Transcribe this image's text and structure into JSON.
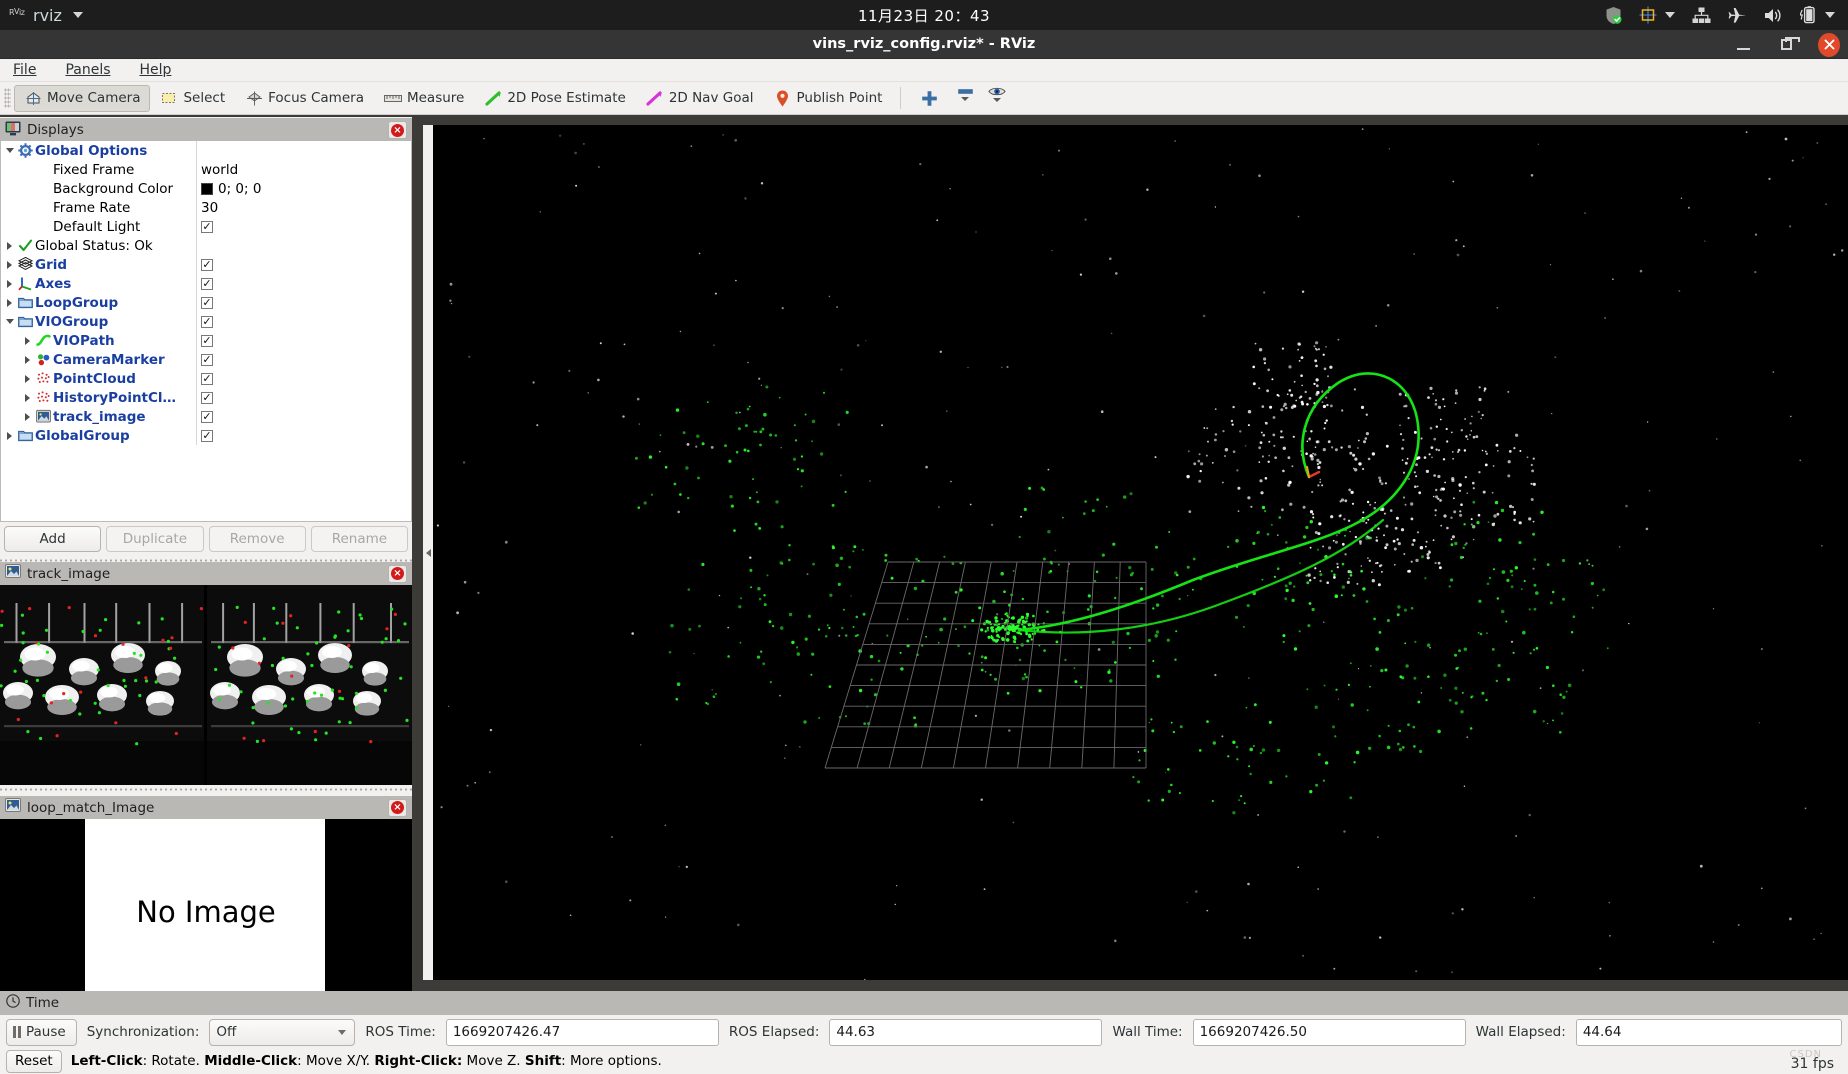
{
  "topbar": {
    "app_menu_label": "rviz",
    "clock": "11月23日  20：43",
    "tray_icons": [
      "shield-check-icon",
      "ime-chinese-icon",
      "network-icon",
      "airplane-mode-icon",
      "volume-icon",
      "battery-charging-icon"
    ]
  },
  "window": {
    "title": "vins_rviz_config.rviz* - RViz",
    "minimize_label": "−",
    "maximize_label": "□",
    "close_label": "✕"
  },
  "menubar": {
    "items": [
      "File",
      "Panels",
      "Help"
    ]
  },
  "toolbar": {
    "buttons": [
      {
        "label": "Move Camera",
        "icon": "move-camera-icon",
        "checked": true
      },
      {
        "label": "Select",
        "icon": "select-icon",
        "checked": false
      },
      {
        "label": "Focus Camera",
        "icon": "focus-camera-icon",
        "checked": false
      },
      {
        "label": "Measure",
        "icon": "measure-icon",
        "checked": false
      },
      {
        "label": "2D Pose Estimate",
        "icon": "pose-estimate-icon",
        "checked": false
      },
      {
        "label": "2D Nav Goal",
        "icon": "nav-goal-icon",
        "checked": false
      },
      {
        "label": "Publish Point",
        "icon": "publish-point-icon",
        "checked": false
      }
    ],
    "extra_icons": [
      "plus-icon",
      "minus-icon",
      "eye-icon"
    ]
  },
  "displays_panel": {
    "title": "Displays",
    "close_label": "×",
    "tree": [
      {
        "indent": 0,
        "twisty": "open",
        "icon": "gear-icon",
        "label": "Global Options",
        "bold": true,
        "value_type": "none",
        "value": ""
      },
      {
        "indent": 1,
        "twisty": "none",
        "icon": "none",
        "label": "Fixed Frame",
        "bold": false,
        "value_type": "text",
        "value": "world"
      },
      {
        "indent": 1,
        "twisty": "none",
        "icon": "none",
        "label": "Background Color",
        "bold": false,
        "value_type": "color",
        "value": "0; 0; 0",
        "color": "#000000"
      },
      {
        "indent": 1,
        "twisty": "none",
        "icon": "none",
        "label": "Frame Rate",
        "bold": false,
        "value_type": "text",
        "value": "30"
      },
      {
        "indent": 1,
        "twisty": "none",
        "icon": "none",
        "label": "Default Light",
        "bold": false,
        "value_type": "checkbox",
        "value": "✓"
      },
      {
        "indent": 0,
        "twisty": "closed",
        "icon": "check-icon",
        "label": "Global Status: Ok",
        "bold": false,
        "value_type": "none",
        "value": ""
      },
      {
        "indent": 0,
        "twisty": "closed",
        "icon": "grid-icon",
        "label": "Grid",
        "bold": true,
        "value_type": "checkbox",
        "value": "✓"
      },
      {
        "indent": 0,
        "twisty": "closed",
        "icon": "axes-icon",
        "label": "Axes",
        "bold": true,
        "value_type": "checkbox",
        "value": "✓"
      },
      {
        "indent": 0,
        "twisty": "closed",
        "icon": "folder-icon",
        "label": "LoopGroup",
        "bold": true,
        "value_type": "checkbox",
        "value": "✓"
      },
      {
        "indent": 0,
        "twisty": "open",
        "icon": "folder-icon",
        "label": "VIOGroup",
        "bold": true,
        "value_type": "checkbox",
        "value": "✓"
      },
      {
        "indent": 1,
        "twisty": "closed",
        "icon": "path-icon",
        "label": "VIOPath",
        "bold": true,
        "value_type": "checkbox",
        "value": "✓"
      },
      {
        "indent": 1,
        "twisty": "closed",
        "icon": "marker-icon",
        "label": "CameraMarker",
        "bold": true,
        "value_type": "checkbox",
        "value": "✓"
      },
      {
        "indent": 1,
        "twisty": "closed",
        "icon": "pointcloud-icon",
        "label": "PointCloud",
        "bold": true,
        "value_type": "checkbox",
        "value": "✓"
      },
      {
        "indent": 1,
        "twisty": "closed",
        "icon": "pointcloud-icon",
        "label": "HistoryPointCl…",
        "bold": true,
        "value_type": "checkbox",
        "value": "✓"
      },
      {
        "indent": 1,
        "twisty": "closed",
        "icon": "image-icon",
        "label": "track_image",
        "bold": true,
        "value_type": "checkbox",
        "value": "✓"
      },
      {
        "indent": 0,
        "twisty": "closed",
        "icon": "folder-icon",
        "label": "GlobalGroup",
        "bold": true,
        "value_type": "checkbox",
        "value": "✓"
      }
    ],
    "buttons": [
      {
        "label": "Add",
        "enabled": true
      },
      {
        "label": "Duplicate",
        "enabled": false
      },
      {
        "label": "Remove",
        "enabled": false
      },
      {
        "label": "Rename",
        "enabled": false
      }
    ]
  },
  "track_image_panel": {
    "title": "track_image",
    "close_label": "×"
  },
  "loop_match_panel": {
    "title": "loop_match_Image",
    "close_label": "×",
    "placeholder_text": "No Image"
  },
  "time_panel": {
    "title": "Time",
    "pause_label": "Pause",
    "sync_label": "Synchronization:",
    "sync_value": "Off",
    "ros_time_label": "ROS Time:",
    "ros_time_value": "1669207426.47",
    "ros_elapsed_label": "ROS Elapsed:",
    "ros_elapsed_value": "44.63",
    "wall_time_label": "Wall Time:",
    "wall_time_value": "1669207426.50",
    "wall_elapsed_label": "Wall Elapsed:",
    "wall_elapsed_value": "44.64",
    "reset_label": "Reset",
    "hint_parts": [
      "Left-Click",
      ": Rotate. ",
      "Middle-Click",
      ": Move X/Y. ",
      "Right-Click:",
      " Move Z. ",
      "Shift",
      ": More options."
    ],
    "fps": "31 fps",
    "watermark": "CSDN"
  },
  "viewport": {
    "background_color": "#000000",
    "grid_color": "#6a6a6a",
    "path_color": "#16e316",
    "pointcloud_color": "#2bff2b",
    "history_pointcloud_color": "#ffffff"
  }
}
